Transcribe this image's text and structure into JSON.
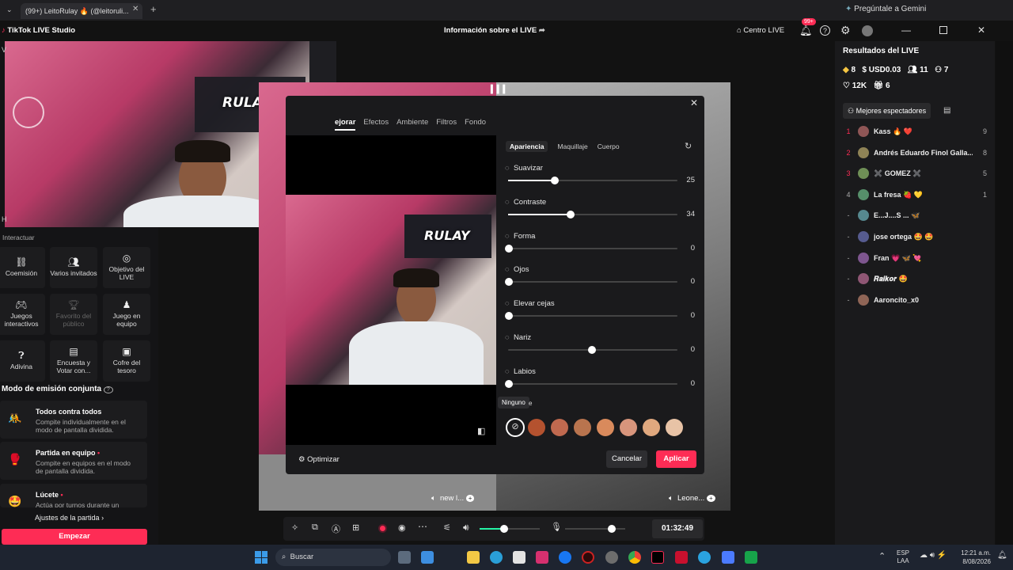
{
  "browser": {
    "tab_title": "(99+) LeitoRulay 🔥 (@leitoruli...",
    "gemini": "Pregúntale a Gemini"
  },
  "app": {
    "title": "TikTok LIVE Studio",
    "center_title": "Información sobre el LIVE",
    "live_center": "Centro LIVE",
    "notif_badge": "99+"
  },
  "left_panel": {
    "section_title": "Interactuar",
    "tiles": [
      {
        "label": "Coemisión",
        "icon": "link-icon"
      },
      {
        "label": "Varios invitados",
        "icon": "users-icon"
      },
      {
        "label": "Objetivo del LIVE",
        "icon": "target-icon"
      },
      {
        "label": "Juegos interactivos",
        "icon": "gamepad-icon"
      },
      {
        "label": "Favorito del público",
        "icon": "trophy-icon"
      },
      {
        "label": "Juego en equipo",
        "icon": "team-icon"
      },
      {
        "label": "Adivina",
        "icon": "question-icon"
      },
      {
        "label": "Encuesta y Votar con...",
        "icon": "poll-icon"
      },
      {
        "label": "Cofre del tesoro",
        "icon": "chest-icon"
      }
    ],
    "coop_title": "Modo de emisión conjunta",
    "coop_items": [
      {
        "title": "Todos contra todos",
        "desc": "Compite individualmente en el modo de pantalla dividida."
      },
      {
        "title": "Partida en equipo",
        "desc": "Compite en equipos en el modo de pantalla dividida."
      },
      {
        "title": "Lúcete",
        "desc": "Actúa por turnos durante un"
      }
    ],
    "settings": "Ajustes de la partida",
    "start": "Empezar"
  },
  "stream": {
    "logo_text": "RULAY",
    "guest1": "new l...",
    "guest2": "Leone...",
    "timer": "01:32:49"
  },
  "dialog": {
    "top_tabs": [
      "ejorar",
      "Efectos",
      "Ambiente",
      "Filtros",
      "Fondo"
    ],
    "sub_tabs": [
      "Apariencia",
      "Maquillaje",
      "Cuerpo"
    ],
    "sliders": [
      {
        "label": "Suavizar",
        "value": "25",
        "ratio": 0.25,
        "icon": "drop-icon"
      },
      {
        "label": "Contraste",
        "value": "34",
        "ratio": 0.34,
        "icon": "contrast-icon"
      },
      {
        "label": "Forma",
        "value": "0",
        "ratio": 0,
        "icon": "face-shape-icon"
      },
      {
        "label": "Ojos",
        "value": "0",
        "ratio": 0,
        "icon": "eye-icon"
      },
      {
        "label": "Elevar cejas",
        "value": "0",
        "ratio": 0,
        "icon": "brow-icon"
      },
      {
        "label": "Nariz",
        "value": "0",
        "ratio": 0.5,
        "icon": "nose-icon"
      },
      {
        "label": "Labios",
        "value": "0",
        "ratio": 0,
        "icon": "lips-icon"
      }
    ],
    "tooltip": "Ninguno",
    "swatches": [
      "#b4522f",
      "#c0694f",
      "#b9744e",
      "#d98a5c",
      "#d8957c",
      "#e0a87e",
      "#e8c3a6"
    ],
    "optimize": "Optimizar",
    "cancel": "Cancelar",
    "apply": "Aplicar"
  },
  "right_panel": {
    "title": "Resultados del LIVE",
    "stats": {
      "coins": "8",
      "usd": "USD0.03",
      "viewers": "11",
      "followers": "7",
      "likes": "12K",
      "gifts": "6"
    },
    "top_viewers_btn": "Mejores espectadores",
    "viewers": [
      {
        "rank": "1",
        "name": "Kass 🔥 ❤️",
        "score": "9"
      },
      {
        "rank": "2",
        "name": "Andrés Eduardo Finol Galla...",
        "score": "8"
      },
      {
        "rank": "3",
        "name": "✖️ GOMEZ ✖️",
        "score": "5"
      },
      {
        "rank": "4",
        "name": "La fresa 🍓 💛",
        "score": "1"
      },
      {
        "rank": "-",
        "name": "E...J....S ... 🦋",
        "score": ""
      },
      {
        "rank": "-",
        "name": "jose ortega 🤩 🤩",
        "score": ""
      },
      {
        "rank": "-",
        "name": "Fran 💗 🦋 💘",
        "score": ""
      },
      {
        "rank": "-",
        "name": "𝑹𝒂𝒊𝒌𝒐𝒓 🤩",
        "score": ""
      },
      {
        "rank": "-",
        "name": "Aaroncito_x0",
        "score": ""
      }
    ]
  },
  "taskbar": {
    "search": "Buscar",
    "lang1": "ESP",
    "lang2": "LAA",
    "time": "12:21 a.m.",
    "date": "8/08/2026"
  }
}
